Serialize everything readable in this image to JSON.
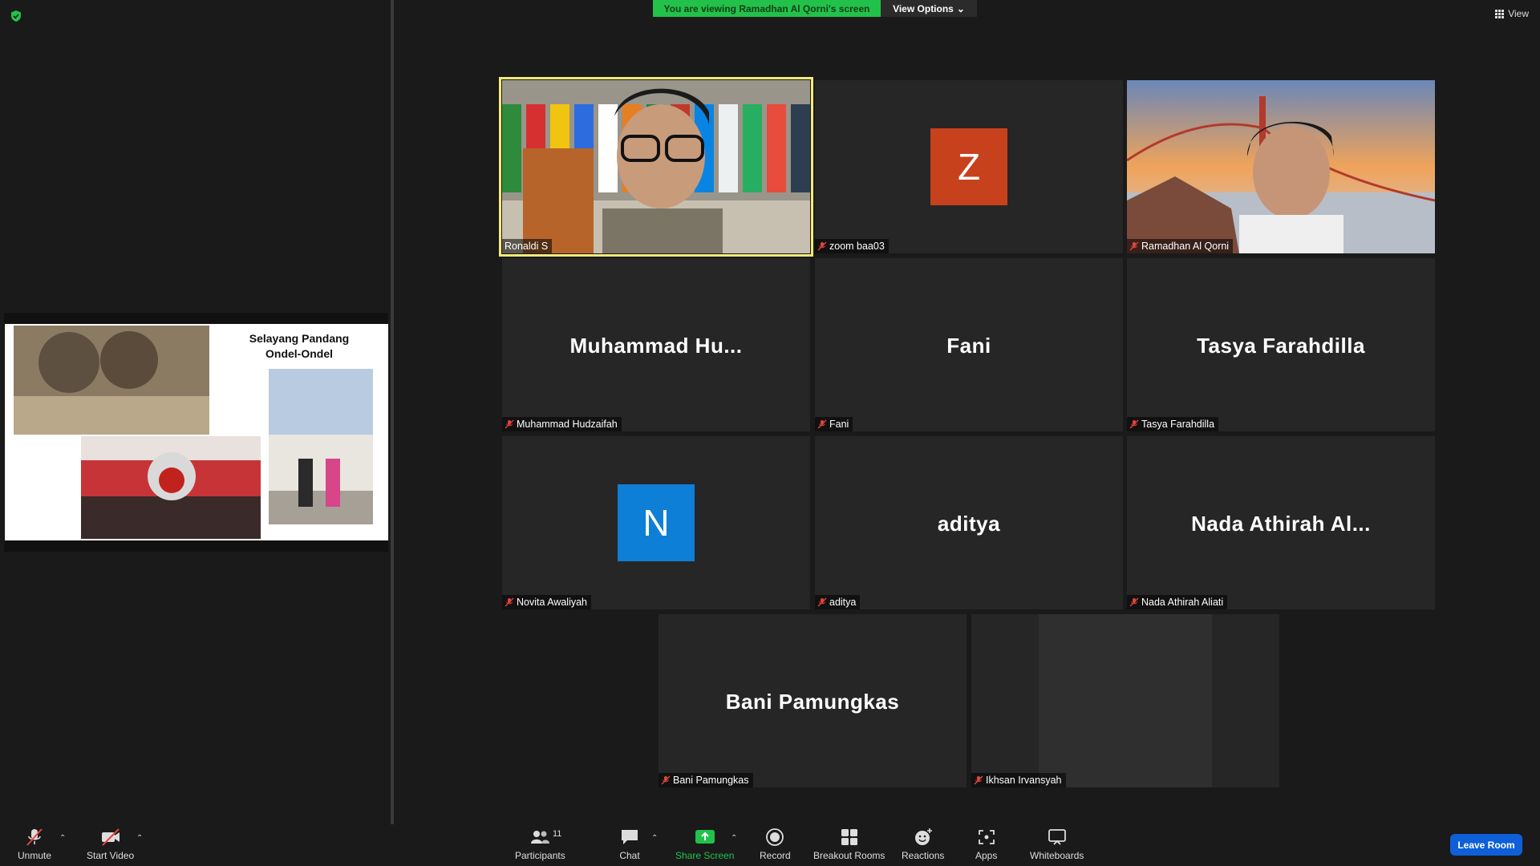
{
  "banner": {
    "text": "You are viewing Ramadhan Al Qorni's screen",
    "view_options": "View Options"
  },
  "view_button": "View",
  "slide": {
    "title_line1": "Selayang Pandang",
    "title_line2": "Ondel-Ondel"
  },
  "tiles": [
    {
      "label": "Ronaldi S",
      "muted": false,
      "video": true,
      "speaking": true
    },
    {
      "label": "zoom baa03",
      "muted": true,
      "avatar": "Z",
      "avatar_color": "#c7411c"
    },
    {
      "label": "Ramadhan Al Qorni",
      "muted": true,
      "video": true
    },
    {
      "label": "Muhammad Hudzaifah",
      "big": "Muhammad  Hu...",
      "muted": true
    },
    {
      "label": "Fani",
      "big": "Fani",
      "muted": true
    },
    {
      "label": "Tasya Farahdilla",
      "big": "Tasya Farahdilla",
      "muted": true
    },
    {
      "label": "Novita Awaliyah",
      "muted": true,
      "avatar": "N",
      "avatar_color": "#0e7fd6"
    },
    {
      "label": "aditya",
      "big": "aditya",
      "muted": true
    },
    {
      "label": "Nada Athirah Aliati",
      "big": "Nada Athirah Al...",
      "muted": true
    },
    {
      "label": "Bani Pamungkas",
      "big": "Bani Pamungkas",
      "muted": true
    },
    {
      "label": "Ikhsan Irvansyah",
      "muted": true,
      "video": true
    }
  ],
  "toolbar": {
    "unmute": "Unmute",
    "start_video": "Start Video",
    "participants": "Participants",
    "participant_count": "11",
    "chat": "Chat",
    "share_screen": "Share Screen",
    "record": "Record",
    "breakout_rooms": "Breakout Rooms",
    "reactions": "Reactions",
    "apps": "Apps",
    "whiteboards": "Whiteboards",
    "leave_room": "Leave Room"
  },
  "colors": {
    "accent_green": "#22c24a",
    "speaker_border": "#f3ea7b",
    "leave_blue": "#0e5fd8",
    "muted_red": "#e0443a"
  }
}
